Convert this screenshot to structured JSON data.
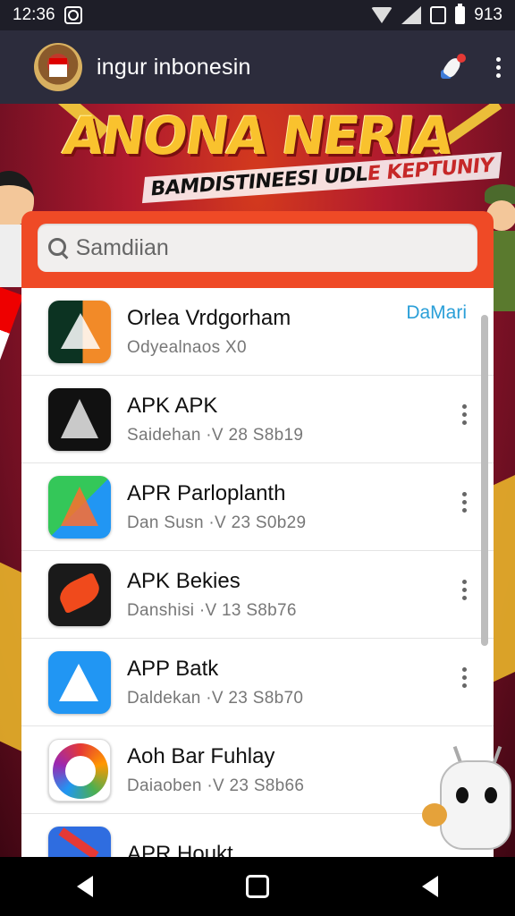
{
  "status_bar": {
    "time": "12:36",
    "battery": "913",
    "icons": [
      "notification-icon",
      "wifi-icon",
      "signal-icon",
      "screen-icon",
      "battery-icon"
    ]
  },
  "app_bar": {
    "title": "ingur inbonesin",
    "icons": [
      "logo-emblem-icon",
      "rocket-icon",
      "more-vert-icon"
    ]
  },
  "banner": {
    "title": "ANONA NERIA",
    "subtitle_a": "BAMDISTINEESI UDL",
    "subtitle_b": "E KEPTUNIY"
  },
  "search": {
    "placeholder": "Samdiian"
  },
  "apps": [
    {
      "name": "Orlea Vrdgorham",
      "meta": "Odyealnaos  X0",
      "action": "DaMari",
      "icon": "orlea-app-icon"
    },
    {
      "name": "APK APK",
      "meta": "Saidehan ·V 28 S8b19",
      "icon": "apk-app-icon"
    },
    {
      "name": "APR Parloplanth",
      "meta": "Dan Susn ·V 23 S0b29",
      "icon": "apr-parloplanth-icon"
    },
    {
      "name": "APK Bekies",
      "meta": "Danshisi ·V 13 S8b76",
      "icon": "apk-bekies-icon"
    },
    {
      "name": "APP Batk",
      "meta": "Daldekan ·V 23 S8b70",
      "icon": "app-batk-icon"
    },
    {
      "name": "Aoh Bar Fuhlay",
      "meta": "Daiaoben ·V 23 S8b66",
      "icon": "aoh-bar-fuhlay-icon"
    },
    {
      "name": "APR Houkt",
      "meta": "",
      "icon": "apr-houkt-icon"
    }
  ],
  "colors": {
    "accent": "#ef4a26",
    "app_bar": "#2c2c3c",
    "link": "#2a9fd8",
    "banner_title": "#f9c22e"
  }
}
